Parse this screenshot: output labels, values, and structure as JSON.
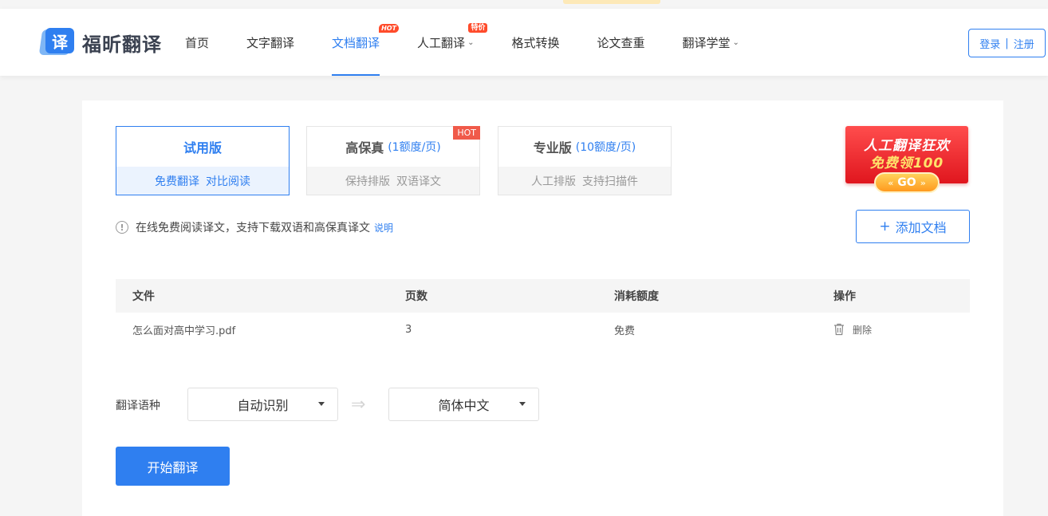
{
  "header": {
    "logo_glyph": "译",
    "logo_text": "福昕翻译",
    "nav": [
      {
        "label": "首页"
      },
      {
        "label": "文字翻译"
      },
      {
        "label": "文档翻译",
        "badge": "HOT",
        "active": true
      },
      {
        "label": "人工翻译",
        "badge": "特价",
        "has_dropdown": true
      },
      {
        "label": "格式转换"
      },
      {
        "label": "论文查重"
      },
      {
        "label": "翻译学堂",
        "has_dropdown": true
      }
    ],
    "login_label": "登录",
    "register_label": "注册",
    "login_separator": "|"
  },
  "plans": [
    {
      "title": "试用版",
      "sub": "",
      "desc1": "免费翻译",
      "desc2": "对比阅读",
      "active": true
    },
    {
      "title": "高保真",
      "sub": "(1额度/页)",
      "desc1": "保持排版",
      "desc2": "双语译文",
      "hot": "HOT"
    },
    {
      "title": "专业版",
      "sub": "(10额度/页)",
      "desc1": "人工排版",
      "desc2": "支持扫描件"
    }
  ],
  "promo": {
    "line1": "人工翻译狂欢",
    "line2": "免费领100",
    "go": "GO",
    "left_arrows": "«",
    "right_arrows": "»"
  },
  "notice": {
    "icon": "info-icon",
    "text": "在线免费阅读译文，支持下载双语和高保真译文",
    "link": "说明"
  },
  "add_doc": {
    "plus": "+",
    "label": "添加文档"
  },
  "table": {
    "headers": [
      "文件",
      "页数",
      "消耗额度",
      "操作"
    ],
    "rows": [
      {
        "file": "怎么面对高中学习.pdf",
        "pages": "3",
        "cost": "免费",
        "action": "删除"
      }
    ]
  },
  "language": {
    "label": "翻译语种",
    "source": "自动识别",
    "swap_icon": "⇒",
    "target": "简体中文"
  },
  "start_button": "开始翻译",
  "colors": {
    "accent": "#2f7ff0",
    "hot": "#f05a4a",
    "background": "#f5f5f5"
  }
}
